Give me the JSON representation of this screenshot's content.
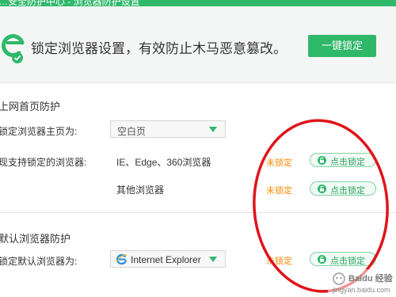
{
  "titlebar": {
    "title": "…安全防护中心 - 浏览器防护设置"
  },
  "banner": {
    "message": "锁定浏览器设置，有效防止木马恶意篡改。",
    "lock_all_label": "一键锁定"
  },
  "homepage_section": {
    "title": "上网首页防护",
    "homepage_label": "锁定浏览器主页为:",
    "homepage_value": "空白页",
    "supported_label": "现支持锁定的浏览器:",
    "browsers": [
      {
        "name": "IE、Edge、360浏览器",
        "status": "未锁定",
        "action": "点击锁定"
      },
      {
        "name": "其他浏览器",
        "status": "未锁定",
        "action": "点击锁定"
      }
    ]
  },
  "default_section": {
    "title": "默认浏览器防护",
    "default_label": "锁定默认浏览器为:",
    "default_value": "Internet Explorer",
    "status": "未锁定",
    "action": "点击锁定"
  },
  "watermark": {
    "text": "Baidu 经验",
    "url": "jingyan.baidu.com"
  },
  "colors": {
    "accent": "#2fb86a",
    "warning": "#ff8a00",
    "annotation": "#e0141b"
  }
}
